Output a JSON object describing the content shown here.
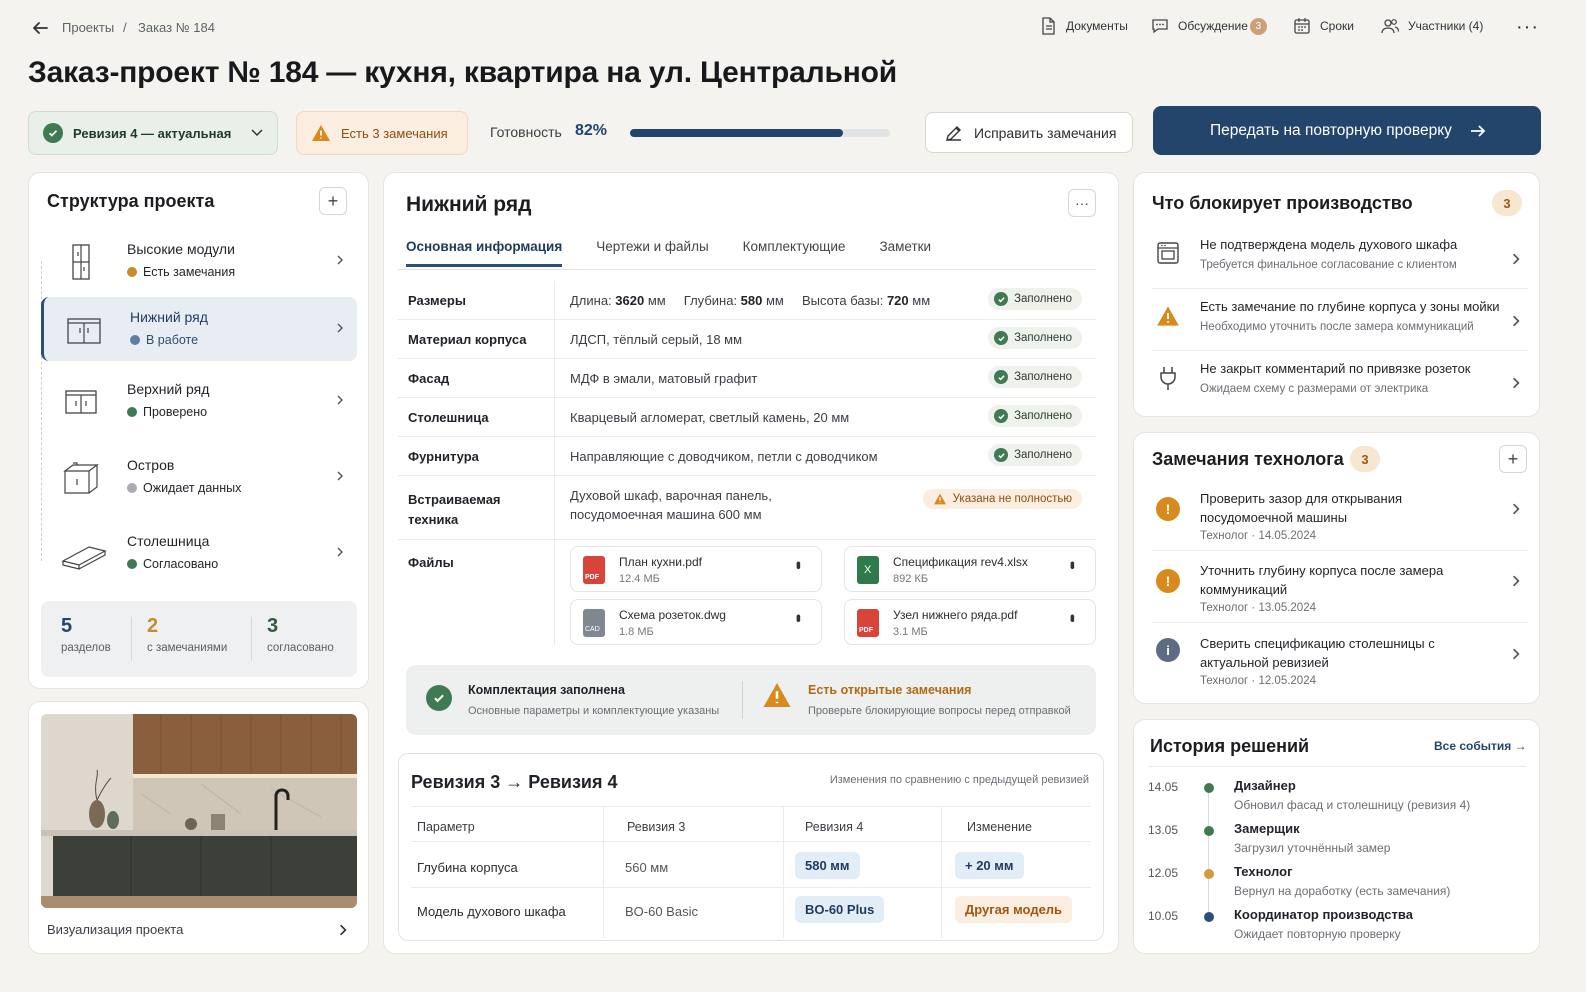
{
  "breadcrumb": {
    "root": "Проекты",
    "sep": "/",
    "current": "Заказ № 184"
  },
  "top_actions": {
    "documents": "Документы",
    "discussion": "Обсуждение",
    "discussion_count": "3",
    "deadlines": "Сроки",
    "participants": "Участники (4)"
  },
  "page_title": "Заказ-проект № 184 — кухня, квартира на ул. Центральной",
  "status_bar": {
    "revision": "Ревизия 4 — актуальная",
    "remarks": "Есть 3 замечания",
    "readiness_label": "Готовность",
    "readiness_value": "82%",
    "readiness_fraction": 0.82,
    "fix_button": "Исправить замечания",
    "submit_button": "Передать на повторную проверку"
  },
  "structure": {
    "title": "Структура проекта",
    "items": [
      {
        "name": "Высокие модули",
        "status": "Есть замечания",
        "status_color": "#c98a2b"
      },
      {
        "name": "Нижний ряд",
        "status": "В работе",
        "status_color": "#5b7ea6"
      },
      {
        "name": "Верхний ряд",
        "status": "Проверено",
        "status_color": "#3f7a52"
      },
      {
        "name": "Остров",
        "status": "Ожидает данных",
        "status_color": "#a9adb2"
      },
      {
        "name": "Столешница",
        "status": "Согласовано",
        "status_color": "#3f7a52"
      }
    ],
    "stats": [
      {
        "value": "5",
        "label": "разделов"
      },
      {
        "value": "2",
        "label": "с замечаниями"
      },
      {
        "value": "3",
        "label": "согласовано"
      }
    ]
  },
  "visualization": {
    "label": "Визуализация проекта"
  },
  "detail": {
    "title": "Нижний ряд",
    "tabs": [
      "Основная информация",
      "Чертежи и файлы",
      "Комплектующие",
      "Заметки"
    ],
    "rows": [
      {
        "key": "Размеры",
        "value_parts": [
          "Длина: ",
          "3620",
          " мм",
          "Глубина: ",
          "580",
          " мм",
          "Высота базы: ",
          "720",
          " мм"
        ],
        "status": "Заполнено"
      },
      {
        "key": "Материал корпуса",
        "value": "ЛДСП, тёплый серый, 18 мм",
        "status": "Заполнено"
      },
      {
        "key": "Фасад",
        "value": "МДФ в эмали, матовый графит",
        "status": "Заполнено"
      },
      {
        "key": "Столешница",
        "value": "Кварцевый агломерат, светлый камень, 20 мм",
        "status": "Заполнено"
      },
      {
        "key": "Фурнитура",
        "value": "Направляющие с доводчиком, петли с доводчиком",
        "status": "Заполнено"
      },
      {
        "key": "Встраиваемая техника",
        "value": "Духовой шкаф, варочная панель, посудомоечная машина 600 мм",
        "status": "Указана не полностью"
      }
    ],
    "files_label": "Файлы",
    "files": [
      {
        "name": "План кухни.pdf",
        "size": "12.4 МБ",
        "type": "PDF"
      },
      {
        "name": "Спецификация rev4.xlsx",
        "size": "892 КБ",
        "type": "X"
      },
      {
        "name": "Схема розеток.dwg",
        "size": "1.8 МБ",
        "type": "CAD"
      },
      {
        "name": "Узел нижнего ряда.pdf",
        "size": "3.1 МБ",
        "type": "PDF"
      }
    ],
    "summary": {
      "ok_title": "Комплектация заполнена",
      "ok_sub": "Основные параметры и комплектующие указаны",
      "warn_title": "Есть открытые замечания",
      "warn_sub": "Проверьте блокирующие вопросы перед отправкой"
    }
  },
  "revision_compare": {
    "title_from": "Ревизия 3",
    "title_to": "Ревизия 4",
    "note": "Изменения по сравнению с предыдущей ревизией",
    "headers": [
      "Параметр",
      "Ревизия 3",
      "Ревизия 4",
      "Изменение"
    ],
    "rows": [
      {
        "param": "Глубина корпуса",
        "r3": "560 мм",
        "r4": "580 мм",
        "change": "+ 20 мм"
      },
      {
        "param": "Модель духового шкафа",
        "r3": "BO-60 Basic",
        "r4": "BO-60 Plus",
        "change": "Другая модель"
      }
    ]
  },
  "blockers": {
    "title": "Что блокирует производство",
    "count": "3",
    "items": [
      {
        "title": "Не подтверждена модель духового шкафа",
        "sub": "Требуется финальное согласование с клиентом",
        "icon": "oven-icon"
      },
      {
        "title": "Есть замечание по глубине корпуса у зоны мойки",
        "sub": "Необходимо уточнить после замера коммуникаций",
        "icon": "warning-icon"
      },
      {
        "title": "Не закрыт комментарий по привязке розеток",
        "sub": "Ожидаем схему с размерами от электрика",
        "icon": "plug-icon"
      }
    ]
  },
  "tech_notes": {
    "title": "Замечания технолога",
    "count": "3",
    "items": [
      {
        "title": "Проверить зазор для открывания посудомоечной машины",
        "author": "Технолог",
        "date": "14.05.2024",
        "kind": "warn"
      },
      {
        "title": "Уточнить глубину корпуса после замера коммуникаций",
        "author": "Технолог",
        "date": "13.05.2024",
        "kind": "warn"
      },
      {
        "title": "Сверить спецификацию столешницы с актуальной ревизией",
        "author": "Технолог",
        "date": "12.05.2024",
        "kind": "info"
      }
    ]
  },
  "history": {
    "title": "История решений",
    "all_link": "Все события",
    "items": [
      {
        "date": "14.05",
        "who": "Дизайнер",
        "what": "Обновил фасад и столешницу (ревизия 4)",
        "color": "#3f7a52"
      },
      {
        "date": "13.05",
        "who": "Замерщик",
        "what": "Загрузил уточнённый замер",
        "color": "#3f7a52"
      },
      {
        "date": "12.05",
        "who": "Технолог",
        "what": "Вернул на доработку (есть замечания)",
        "color": "#d69a3a"
      },
      {
        "date": "10.05",
        "who": "Координатор производства",
        "what": "Ожидает повторную проверку",
        "color": "#2a4f7a"
      }
    ]
  },
  "colors": {
    "accent": "#23456b",
    "warn": "#d28a1f",
    "ok": "#3f7a52"
  }
}
